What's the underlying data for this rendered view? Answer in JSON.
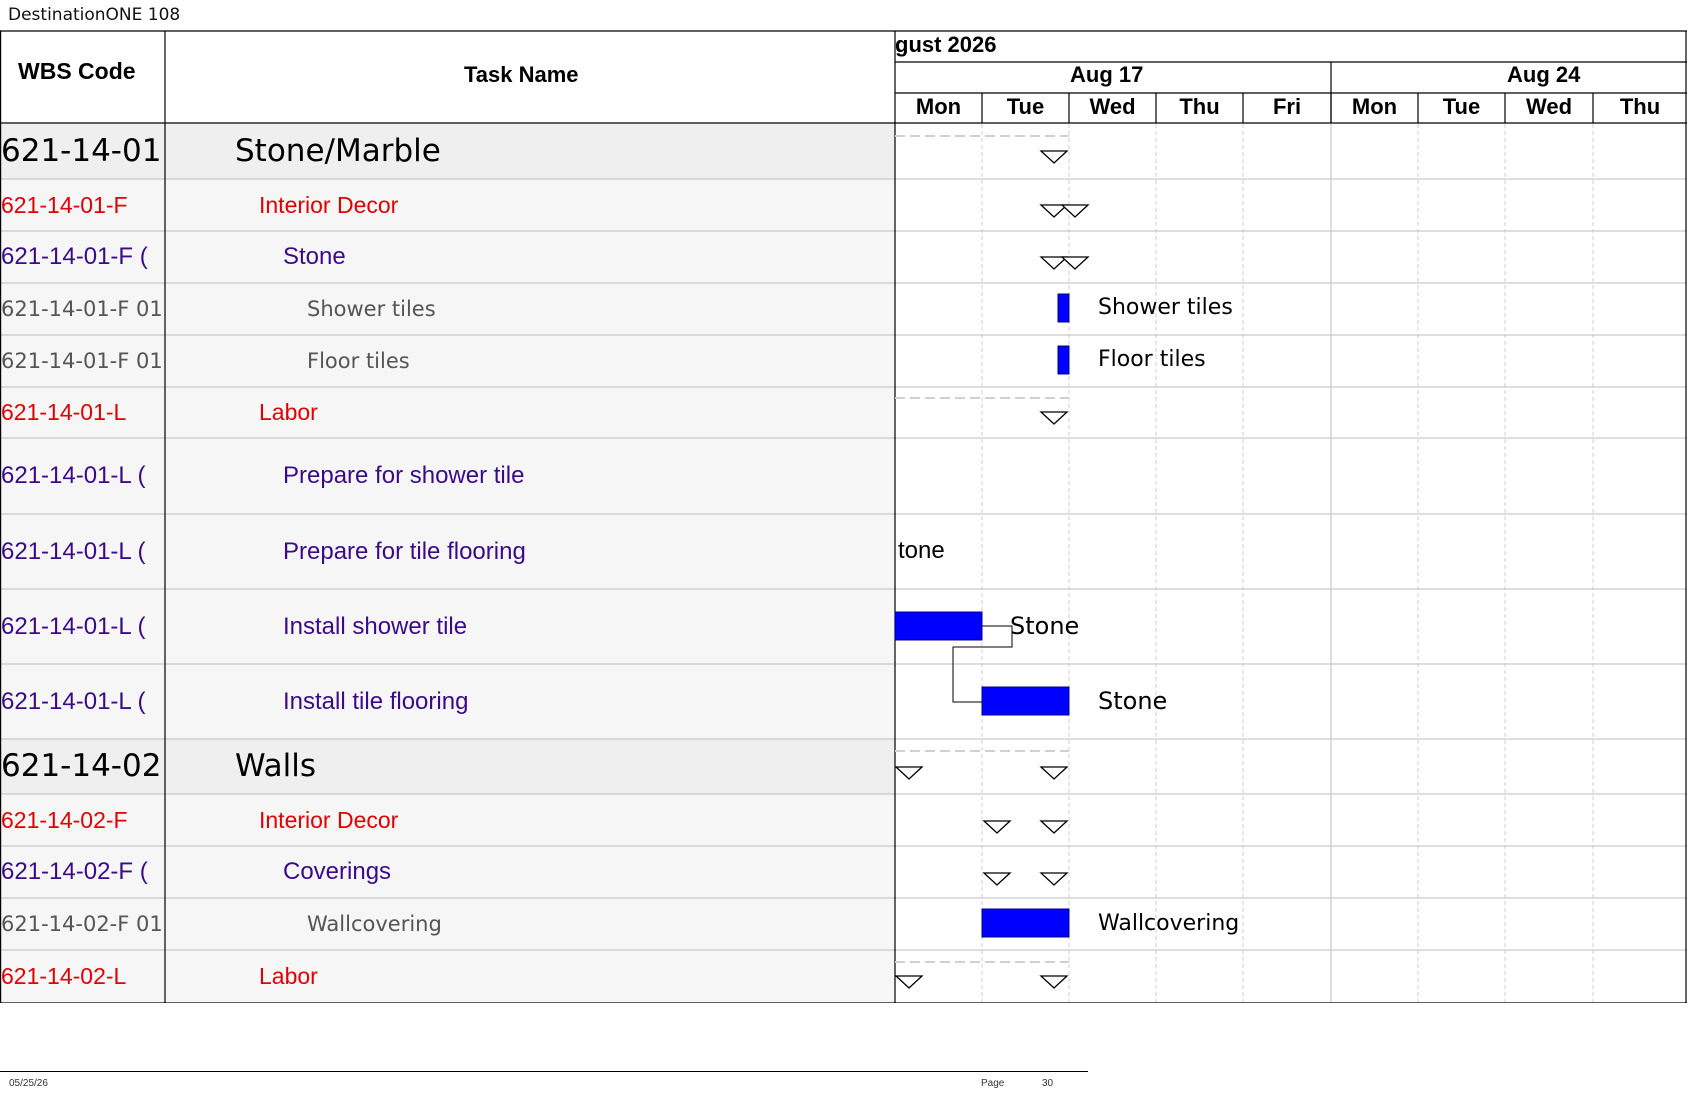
{
  "header": {
    "title": "DestinationONE 108"
  },
  "columns": {
    "wbs": "WBS Code",
    "task": "Task Name"
  },
  "timeline": {
    "month": "gust 2026",
    "weeks": [
      "Aug 17",
      "Aug 24"
    ],
    "days": [
      "Mon",
      "Tue",
      "Wed",
      "Thu",
      "Fri",
      "Mon",
      "Tue",
      "Wed",
      "Thu"
    ]
  },
  "rows": [
    {
      "wbs": "621-14-01",
      "task": "Stone/Marble",
      "level": 1
    },
    {
      "wbs": "621-14-01-F",
      "task": "Interior Decor",
      "level": 2
    },
    {
      "wbs": "621-14-01-F (",
      "task": "Stone",
      "level": 3
    },
    {
      "wbs": "621-14-01-F 01",
      "task": "Shower tiles",
      "level": 4
    },
    {
      "wbs": "621-14-01-F 01",
      "task": "Floor tiles",
      "level": 4
    },
    {
      "wbs": "621-14-01-L",
      "task": "Labor",
      "level": 2
    },
    {
      "wbs": "621-14-01-L (",
      "task": "Prepare for shower tile",
      "level": 3
    },
    {
      "wbs": "621-14-01-L (",
      "task": "Prepare for tile flooring",
      "level": 3
    },
    {
      "wbs": "621-14-01-L (",
      "task": "Install shower tile",
      "level": 3
    },
    {
      "wbs": "621-14-01-L (",
      "task": "Install tile flooring",
      "level": 3
    },
    {
      "wbs": "621-14-02",
      "task": "Walls",
      "level": 1
    },
    {
      "wbs": "621-14-02-F",
      "task": "Interior Decor",
      "level": 2
    },
    {
      "wbs": "621-14-02-F (",
      "task": "Coverings",
      "level": 3
    },
    {
      "wbs": "621-14-02-F 01",
      "task": "Wallcovering",
      "level": 4
    },
    {
      "wbs": "621-14-02-L",
      "task": "Labor",
      "level": 2
    }
  ],
  "bar_labels": {
    "shower_tiles": "Shower tiles",
    "floor_tiles": "Floor tiles",
    "prep_flooring": "tone",
    "install_shower": "Stone",
    "install_flooring": "Stone",
    "wallcovering": "Wallcovering"
  },
  "colors": {
    "bar": "#0000ff",
    "level1": "#000000",
    "level2": "#e00000",
    "level3": "#3a0a8a",
    "level4": "#555555"
  },
  "footer": {
    "date": "05/25/26",
    "page_label": "Page",
    "page_number": "30"
  }
}
